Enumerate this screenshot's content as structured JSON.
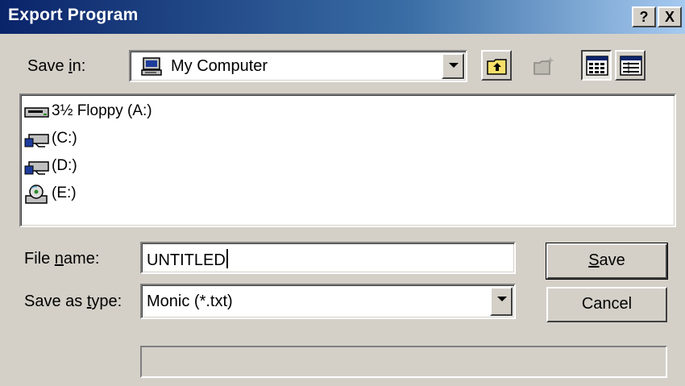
{
  "window": {
    "title": "Export Program",
    "help_glyph": "?",
    "close_glyph": "X"
  },
  "save_in": {
    "label_pre": "Save ",
    "label_accel": "i",
    "label_post": "n:",
    "value": "My Computer"
  },
  "toolbar": {
    "buttons": [
      {
        "name": "up-one-level",
        "icon": "folder-up-icon"
      },
      {
        "name": "create-new-folder",
        "icon": "new-folder-icon",
        "disabled": true
      },
      {
        "name": "list-view",
        "icon": "list-view-icon",
        "pressed": true
      },
      {
        "name": "details-view",
        "icon": "details-view-icon"
      }
    ]
  },
  "files": [
    {
      "label": "3½ Floppy (A:)",
      "icon": "floppy-drive-icon"
    },
    {
      "label": "(C:)",
      "icon": "network-drive-icon"
    },
    {
      "label": "(D:)",
      "icon": "network-drive-icon"
    },
    {
      "label": "(E:)",
      "icon": "cd-drive-icon"
    }
  ],
  "file_name": {
    "label_pre": "File ",
    "label_accel": "n",
    "label_post": "ame:",
    "value": "UNTITLED"
  },
  "save_as_type": {
    "label_pre": "Save as ",
    "label_accel": "t",
    "label_post": "ype:",
    "value": "Monic (*.txt)"
  },
  "buttons": {
    "save_accel": "S",
    "save_rest": "ave",
    "cancel": "Cancel"
  },
  "colors": {
    "titlebar_start": "#0a246a",
    "titlebar_end": "#a6caf0",
    "face": "#d4d0c8"
  }
}
